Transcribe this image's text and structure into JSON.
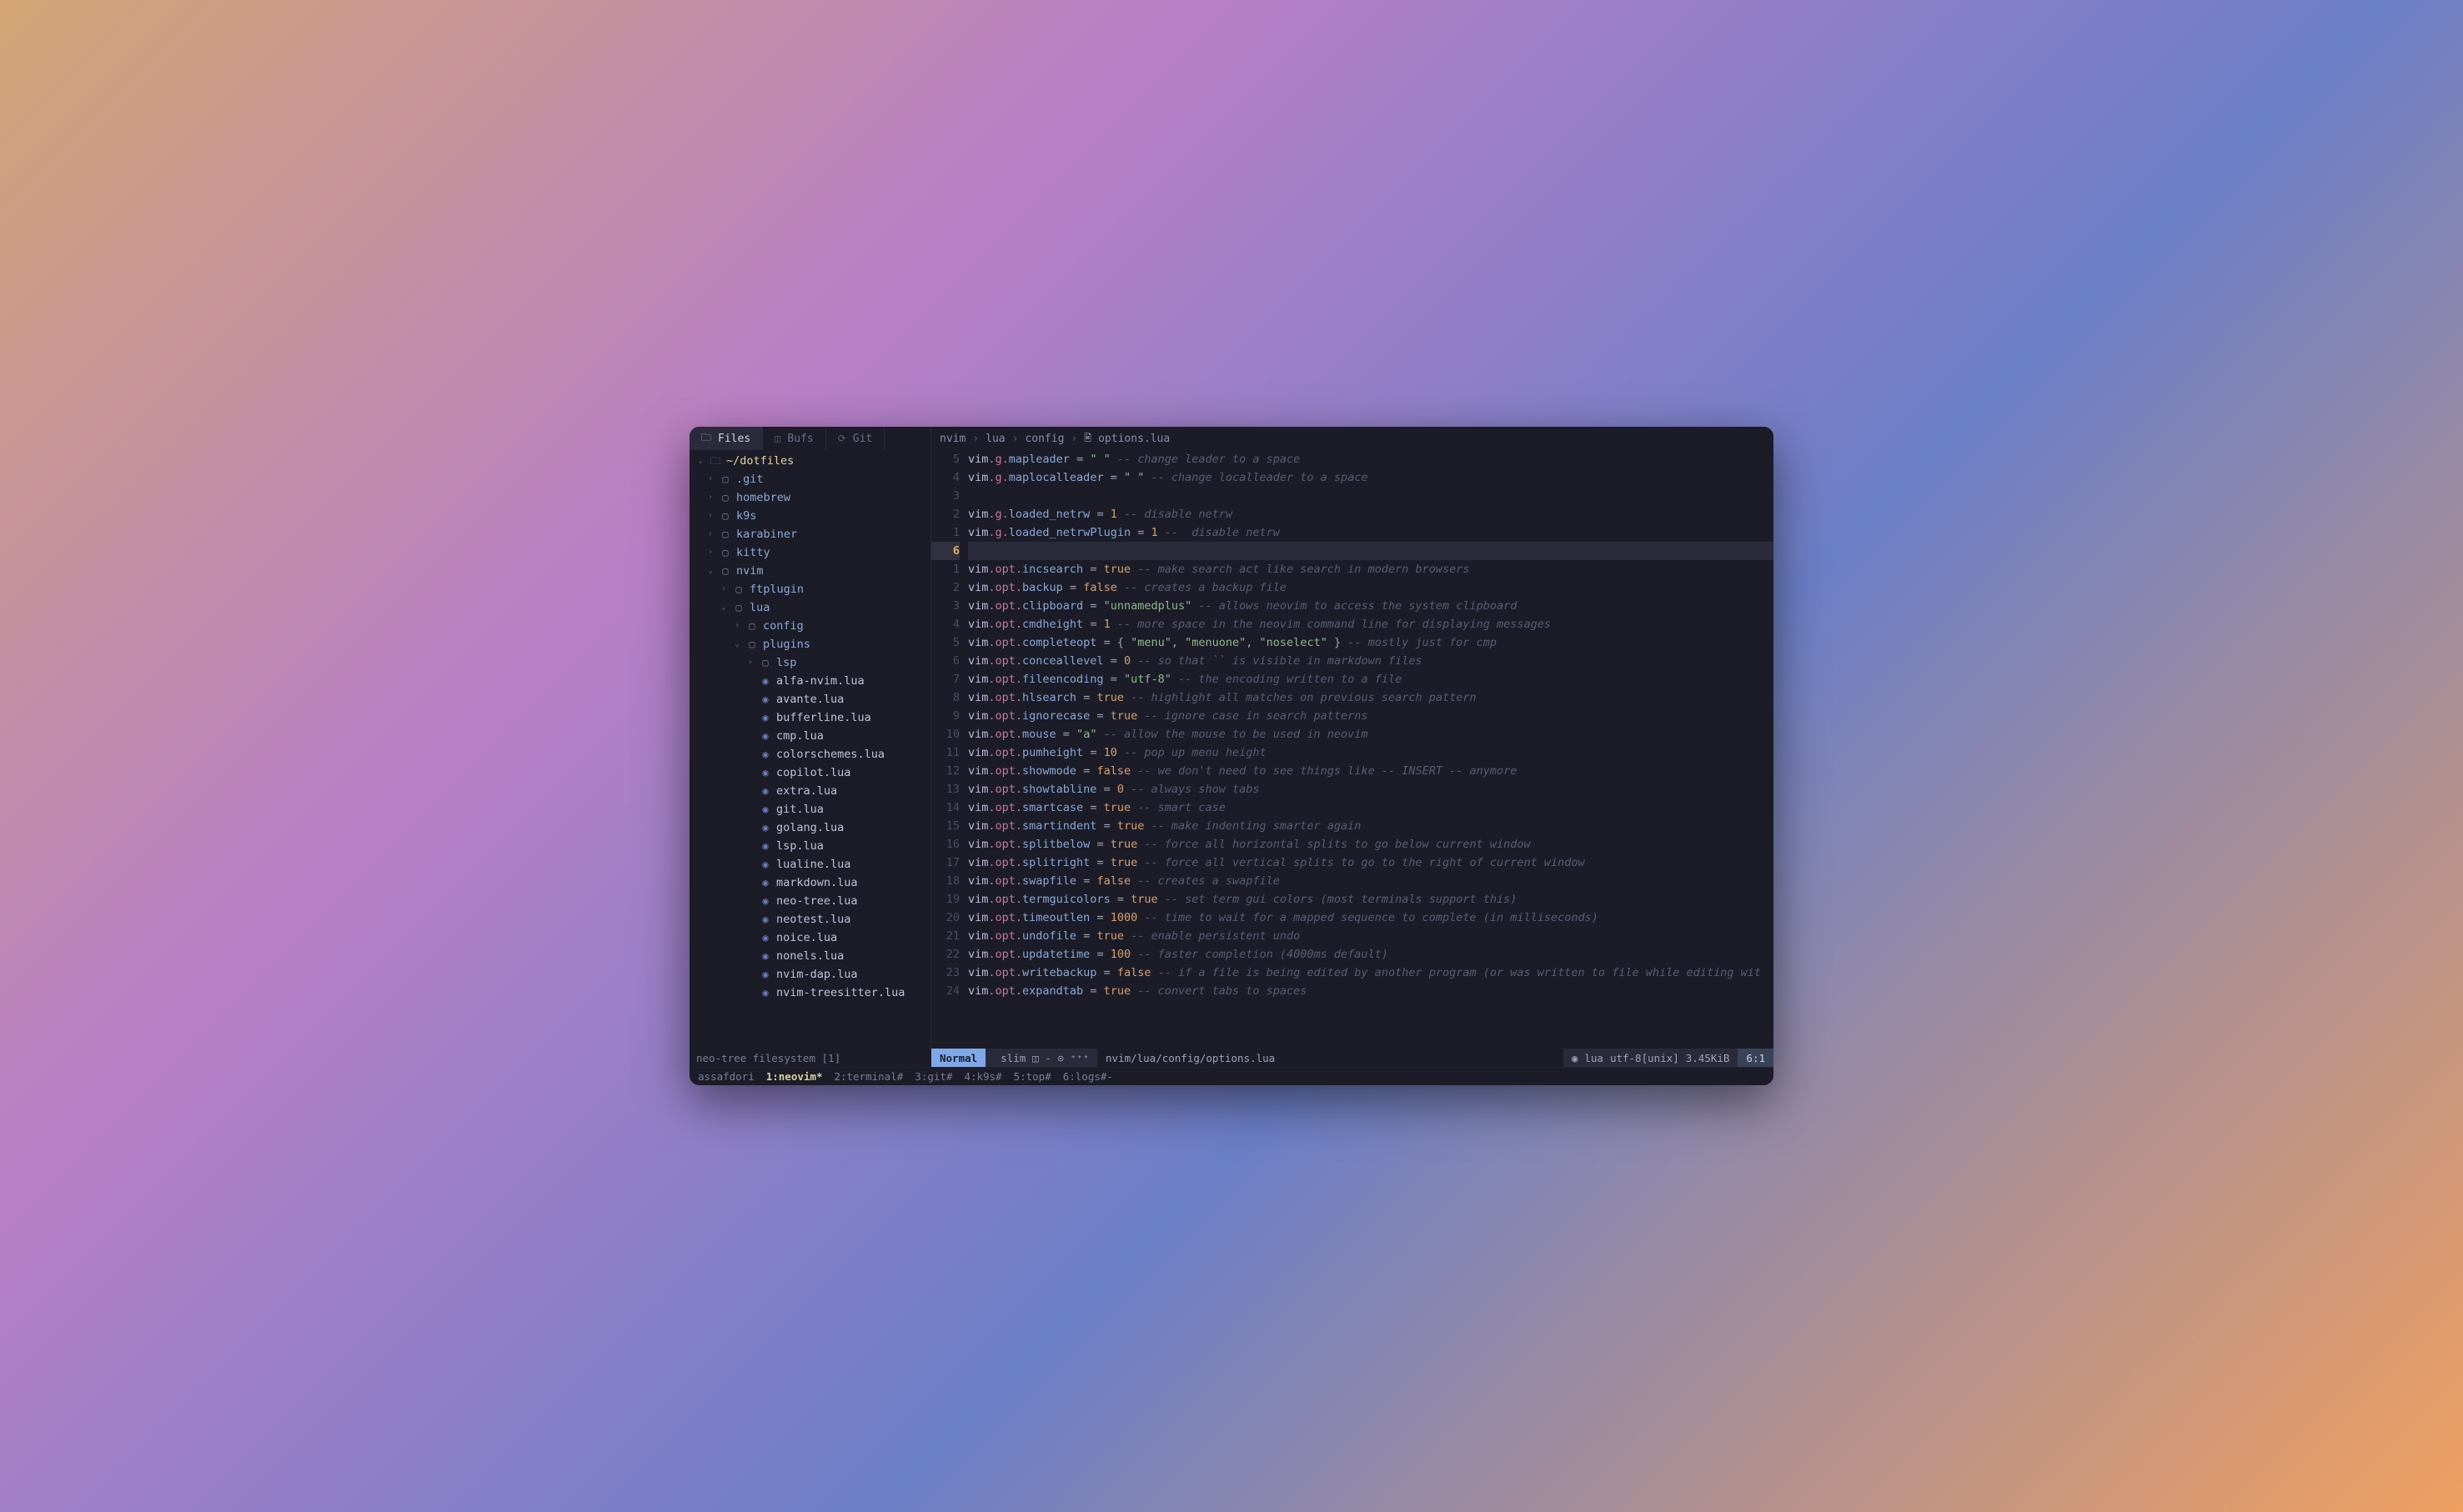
{
  "sidebar": {
    "tabs": [
      {
        "icon": "🗀",
        "label": "Files",
        "active": true
      },
      {
        "icon": "◫",
        "label": "Bufs",
        "active": false
      },
      {
        "icon": "⟳",
        "label": "Git",
        "active": false
      }
    ],
    "root": {
      "icon": "🗀",
      "label": "~/dotfiles"
    },
    "tree": [
      {
        "depth": 1,
        "kind": "dir",
        "chev": "›",
        "label": ".git"
      },
      {
        "depth": 1,
        "kind": "dir",
        "chev": "›",
        "label": "homebrew"
      },
      {
        "depth": 1,
        "kind": "dir",
        "chev": "›",
        "label": "k9s"
      },
      {
        "depth": 1,
        "kind": "dir",
        "chev": "›",
        "label": "karabiner"
      },
      {
        "depth": 1,
        "kind": "dir",
        "chev": "›",
        "label": "kitty"
      },
      {
        "depth": 1,
        "kind": "dir",
        "chev": "⌄",
        "label": "nvim"
      },
      {
        "depth": 2,
        "kind": "dir",
        "chev": "›",
        "label": "ftplugin"
      },
      {
        "depth": 2,
        "kind": "dir",
        "chev": "⌄",
        "label": "lua"
      },
      {
        "depth": 3,
        "kind": "dir",
        "chev": "›",
        "label": "config"
      },
      {
        "depth": 3,
        "kind": "dir",
        "chev": "⌄",
        "label": "plugins"
      },
      {
        "depth": 4,
        "kind": "dir",
        "chev": "›",
        "label": "lsp"
      },
      {
        "depth": 4,
        "kind": "file",
        "label": "alfa-nvim.lua"
      },
      {
        "depth": 4,
        "kind": "file",
        "label": "avante.lua"
      },
      {
        "depth": 4,
        "kind": "file",
        "label": "bufferline.lua"
      },
      {
        "depth": 4,
        "kind": "file",
        "label": "cmp.lua"
      },
      {
        "depth": 4,
        "kind": "file",
        "label": "colorschemes.lua"
      },
      {
        "depth": 4,
        "kind": "file",
        "label": "copilot.lua"
      },
      {
        "depth": 4,
        "kind": "file",
        "label": "extra.lua"
      },
      {
        "depth": 4,
        "kind": "file",
        "label": "git.lua"
      },
      {
        "depth": 4,
        "kind": "file",
        "label": "golang.lua"
      },
      {
        "depth": 4,
        "kind": "file",
        "label": "lsp.lua"
      },
      {
        "depth": 4,
        "kind": "file",
        "label": "lualine.lua"
      },
      {
        "depth": 4,
        "kind": "file",
        "label": "markdown.lua"
      },
      {
        "depth": 4,
        "kind": "file",
        "label": "neo-tree.lua"
      },
      {
        "depth": 4,
        "kind": "file",
        "label": "neotest.lua"
      },
      {
        "depth": 4,
        "kind": "file",
        "label": "noice.lua"
      },
      {
        "depth": 4,
        "kind": "file",
        "label": "nonels.lua"
      },
      {
        "depth": 4,
        "kind": "file",
        "label": "nvim-dap.lua"
      },
      {
        "depth": 4,
        "kind": "file",
        "label": "nvim-treesitter.lua"
      }
    ]
  },
  "breadcrumb": {
    "segments": [
      "nvim",
      "lua",
      "config"
    ],
    "file_icon": "🖹",
    "filename": "options.lua"
  },
  "gutter": [
    "5",
    "4",
    "3",
    "2",
    "1",
    "6",
    "1",
    "2",
    "3",
    "4",
    "5",
    "6",
    "7",
    "8",
    "9",
    "10",
    "11",
    "12",
    "13",
    "14",
    "15",
    "16",
    "17",
    "18",
    "19",
    "20",
    "21",
    "22",
    "23",
    "24"
  ],
  "gutter_cursor_index": 5,
  "code": [
    {
      "t": [
        [
          "vim",
          "vim"
        ],
        [
          "key",
          ".g."
        ],
        [
          "prop",
          "mapleader"
        ],
        [
          "op",
          " = "
        ],
        [
          "str",
          "\" \""
        ],
        [
          "comment",
          " -- change leader to a space"
        ]
      ]
    },
    {
      "t": [
        [
          "vim",
          "vim"
        ],
        [
          "key",
          ".g."
        ],
        [
          "prop",
          "maplocalleader"
        ],
        [
          "op",
          " = "
        ],
        [
          "str",
          "\" \""
        ],
        [
          "comment",
          " -- change localleader to a space"
        ]
      ]
    },
    {
      "t": []
    },
    {
      "t": [
        [
          "vim",
          "vim"
        ],
        [
          "key",
          ".g."
        ],
        [
          "prop",
          "loaded_netrw"
        ],
        [
          "op",
          " = "
        ],
        [
          "num",
          "1"
        ],
        [
          "comment",
          " -- disable netrw"
        ]
      ]
    },
    {
      "t": [
        [
          "vim",
          "vim"
        ],
        [
          "key",
          ".g."
        ],
        [
          "prop",
          "loaded_netrwPlugin"
        ],
        [
          "op",
          " = "
        ],
        [
          "num",
          "1"
        ],
        [
          "comment",
          " --  disable netrw"
        ]
      ]
    },
    {
      "t": [],
      "cursor": true
    },
    {
      "t": [
        [
          "vim",
          "vim"
        ],
        [
          "key",
          ".opt."
        ],
        [
          "prop",
          "incsearch"
        ],
        [
          "op",
          " = "
        ],
        [
          "bool",
          "true"
        ],
        [
          "comment",
          " -- make search act like search in modern browsers"
        ]
      ]
    },
    {
      "t": [
        [
          "vim",
          "vim"
        ],
        [
          "key",
          ".opt."
        ],
        [
          "prop",
          "backup"
        ],
        [
          "op",
          " = "
        ],
        [
          "bool",
          "false"
        ],
        [
          "comment",
          " -- creates a backup file"
        ]
      ]
    },
    {
      "t": [
        [
          "vim",
          "vim"
        ],
        [
          "key",
          ".opt."
        ],
        [
          "prop",
          "clipboard"
        ],
        [
          "op",
          " = "
        ],
        [
          "str",
          "\"unnamedplus\""
        ],
        [
          "comment",
          " -- allows neovim to access the system clipboard"
        ]
      ]
    },
    {
      "t": [
        [
          "vim",
          "vim"
        ],
        [
          "key",
          ".opt."
        ],
        [
          "prop",
          "cmdheight"
        ],
        [
          "op",
          " = "
        ],
        [
          "num",
          "1"
        ],
        [
          "comment",
          " -- more space in the neovim command line for displaying messages"
        ]
      ]
    },
    {
      "t": [
        [
          "vim",
          "vim"
        ],
        [
          "key",
          ".opt."
        ],
        [
          "prop",
          "completeopt"
        ],
        [
          "op",
          " = { "
        ],
        [
          "str",
          "\"menu\""
        ],
        [
          "op",
          ", "
        ],
        [
          "str",
          "\"menuone\""
        ],
        [
          "op",
          ", "
        ],
        [
          "str",
          "\"noselect\""
        ],
        [
          "op",
          " }"
        ],
        [
          "comment",
          " -- mostly just for cmp"
        ]
      ]
    },
    {
      "t": [
        [
          "vim",
          "vim"
        ],
        [
          "key",
          ".opt."
        ],
        [
          "prop",
          "conceallevel"
        ],
        [
          "op",
          " = "
        ],
        [
          "num",
          "0"
        ],
        [
          "comment",
          " -- so that `` is visible in markdown files"
        ]
      ]
    },
    {
      "t": [
        [
          "vim",
          "vim"
        ],
        [
          "key",
          ".opt."
        ],
        [
          "prop",
          "fileencoding"
        ],
        [
          "op",
          " = "
        ],
        [
          "str",
          "\"utf-8\""
        ],
        [
          "comment",
          " -- the encoding written to a file"
        ]
      ]
    },
    {
      "t": [
        [
          "vim",
          "vim"
        ],
        [
          "key",
          ".opt."
        ],
        [
          "prop",
          "hlsearch"
        ],
        [
          "op",
          " = "
        ],
        [
          "bool",
          "true"
        ],
        [
          "comment",
          " -- highlight all matches on previous search pattern"
        ]
      ]
    },
    {
      "t": [
        [
          "vim",
          "vim"
        ],
        [
          "key",
          ".opt."
        ],
        [
          "prop",
          "ignorecase"
        ],
        [
          "op",
          " = "
        ],
        [
          "bool",
          "true"
        ],
        [
          "comment",
          " -- ignore case in search patterns"
        ]
      ]
    },
    {
      "t": [
        [
          "vim",
          "vim"
        ],
        [
          "key",
          ".opt."
        ],
        [
          "prop",
          "mouse"
        ],
        [
          "op",
          " = "
        ],
        [
          "str",
          "\"a\""
        ],
        [
          "comment",
          " -- allow the mouse to be used in neovim"
        ]
      ]
    },
    {
      "t": [
        [
          "vim",
          "vim"
        ],
        [
          "key",
          ".opt."
        ],
        [
          "prop",
          "pumheight"
        ],
        [
          "op",
          " = "
        ],
        [
          "num",
          "10"
        ],
        [
          "comment",
          " -- pop up menu height"
        ]
      ]
    },
    {
      "t": [
        [
          "vim",
          "vim"
        ],
        [
          "key",
          ".opt."
        ],
        [
          "prop",
          "showmode"
        ],
        [
          "op",
          " = "
        ],
        [
          "bool",
          "false"
        ],
        [
          "comment",
          " -- we don't need to see things like -- INSERT -- anymore"
        ]
      ]
    },
    {
      "t": [
        [
          "vim",
          "vim"
        ],
        [
          "key",
          ".opt."
        ],
        [
          "prop",
          "showtabline"
        ],
        [
          "op",
          " = "
        ],
        [
          "num",
          "0"
        ],
        [
          "comment",
          " -- always show tabs"
        ]
      ]
    },
    {
      "t": [
        [
          "vim",
          "vim"
        ],
        [
          "key",
          ".opt."
        ],
        [
          "prop",
          "smartcase"
        ],
        [
          "op",
          " = "
        ],
        [
          "bool",
          "true"
        ],
        [
          "comment",
          " -- smart case"
        ]
      ]
    },
    {
      "t": [
        [
          "vim",
          "vim"
        ],
        [
          "key",
          ".opt."
        ],
        [
          "prop",
          "smartindent"
        ],
        [
          "op",
          " = "
        ],
        [
          "bool",
          "true"
        ],
        [
          "comment",
          " -- make indenting smarter again"
        ]
      ]
    },
    {
      "t": [
        [
          "vim",
          "vim"
        ],
        [
          "key",
          ".opt."
        ],
        [
          "prop",
          "splitbelow"
        ],
        [
          "op",
          " = "
        ],
        [
          "bool",
          "true"
        ],
        [
          "comment",
          " -- force all horizontal splits to go below current window"
        ]
      ]
    },
    {
      "t": [
        [
          "vim",
          "vim"
        ],
        [
          "key",
          ".opt."
        ],
        [
          "prop",
          "splitright"
        ],
        [
          "op",
          " = "
        ],
        [
          "bool",
          "true"
        ],
        [
          "comment",
          " -- force all vertical splits to go to the right of current window"
        ]
      ]
    },
    {
      "t": [
        [
          "vim",
          "vim"
        ],
        [
          "key",
          ".opt."
        ],
        [
          "prop",
          "swapfile"
        ],
        [
          "op",
          " = "
        ],
        [
          "bool",
          "false"
        ],
        [
          "comment",
          " -- creates a swapfile"
        ]
      ]
    },
    {
      "t": [
        [
          "vim",
          "vim"
        ],
        [
          "key",
          ".opt."
        ],
        [
          "prop",
          "termguicolors"
        ],
        [
          "op",
          " = "
        ],
        [
          "bool",
          "true"
        ],
        [
          "comment",
          " -- set term gui colors (most terminals support this)"
        ]
      ]
    },
    {
      "t": [
        [
          "vim",
          "vim"
        ],
        [
          "key",
          ".opt."
        ],
        [
          "prop",
          "timeoutlen"
        ],
        [
          "op",
          " = "
        ],
        [
          "num",
          "1000"
        ],
        [
          "comment",
          " -- time to wait for a mapped sequence to complete (in milliseconds)"
        ]
      ]
    },
    {
      "t": [
        [
          "vim",
          "vim"
        ],
        [
          "key",
          ".opt."
        ],
        [
          "prop",
          "undofile"
        ],
        [
          "op",
          " = "
        ],
        [
          "bool",
          "true"
        ],
        [
          "comment",
          " -- enable persistent undo"
        ]
      ]
    },
    {
      "t": [
        [
          "vim",
          "vim"
        ],
        [
          "key",
          ".opt."
        ],
        [
          "prop",
          "updatetime"
        ],
        [
          "op",
          " = "
        ],
        [
          "num",
          "100"
        ],
        [
          "comment",
          " -- faster completion (4000ms default)"
        ]
      ]
    },
    {
      "t": [
        [
          "vim",
          "vim"
        ],
        [
          "key",
          ".opt."
        ],
        [
          "prop",
          "writebackup"
        ],
        [
          "op",
          " = "
        ],
        [
          "bool",
          "false"
        ],
        [
          "comment",
          " -- if a file is being edited by another program (or was written to file while editing wit"
        ]
      ]
    },
    {
      "t": [
        [
          "vim",
          "vim"
        ],
        [
          "key",
          ".opt."
        ],
        [
          "prop",
          "expandtab"
        ],
        [
          "op",
          " = "
        ],
        [
          "bool",
          "true"
        ],
        [
          "comment",
          " -- convert tabs to spaces"
        ]
      ]
    }
  ],
  "status": {
    "neotree": "neo-tree filesystem [1]",
    "mode": "Normal",
    "git_branch_icon": "",
    "git_branch": "slim",
    "git_extra": "◫ - ⊙ ⁺⁺⁺",
    "path": "nvim/lua/config/options.lua",
    "file_icon": "◉",
    "filetype": "lua",
    "encoding": "utf-8[unix]",
    "size": "3.45KiB",
    "position": "6:1"
  },
  "tmux": {
    "session": "assafdori",
    "windows": [
      {
        "label": "1:neovim*",
        "active": true
      },
      {
        "label": "2:terminal#",
        "active": false
      },
      {
        "label": "3:git#",
        "active": false
      },
      {
        "label": "4:k9s#",
        "active": false
      },
      {
        "label": "5:top#",
        "active": false
      },
      {
        "label": "6:logs#-",
        "active": false
      }
    ]
  }
}
